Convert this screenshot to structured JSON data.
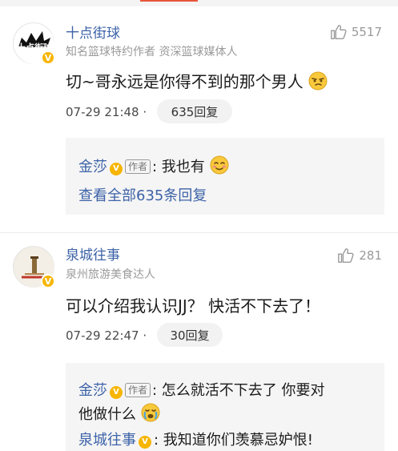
{
  "comments": [
    {
      "avatar_text": "十点街球",
      "username": "十点街球",
      "verified": "知名篮球特约作者 资深篮球媒体人",
      "likes": "5517",
      "text": "切~哥永远是你得不到的那个男人",
      "time": "07-29 21:48 ·",
      "reply_label": "635回复",
      "reply": {
        "name": "金莎",
        "author_tag": "作者",
        "text": ": 我也有",
        "view_all": "查看全部635条回复"
      }
    },
    {
      "username": "泉城往事",
      "verified": "泉州旅游美食达人",
      "likes": "281",
      "text": "可以介绍我认识JJ？ 快活不下去了！",
      "time": "07-29 22:47 ·",
      "reply_label": "30回复",
      "reply": {
        "name": "金莎",
        "author_tag": "作者",
        "text_line1": ": 怎么就活不下去了 你要对",
        "text_line2": "他做什么",
        "second_name": "泉城往事",
        "second_text": ": 我知道你们羡慕忌妒恨!"
      }
    }
  ]
}
